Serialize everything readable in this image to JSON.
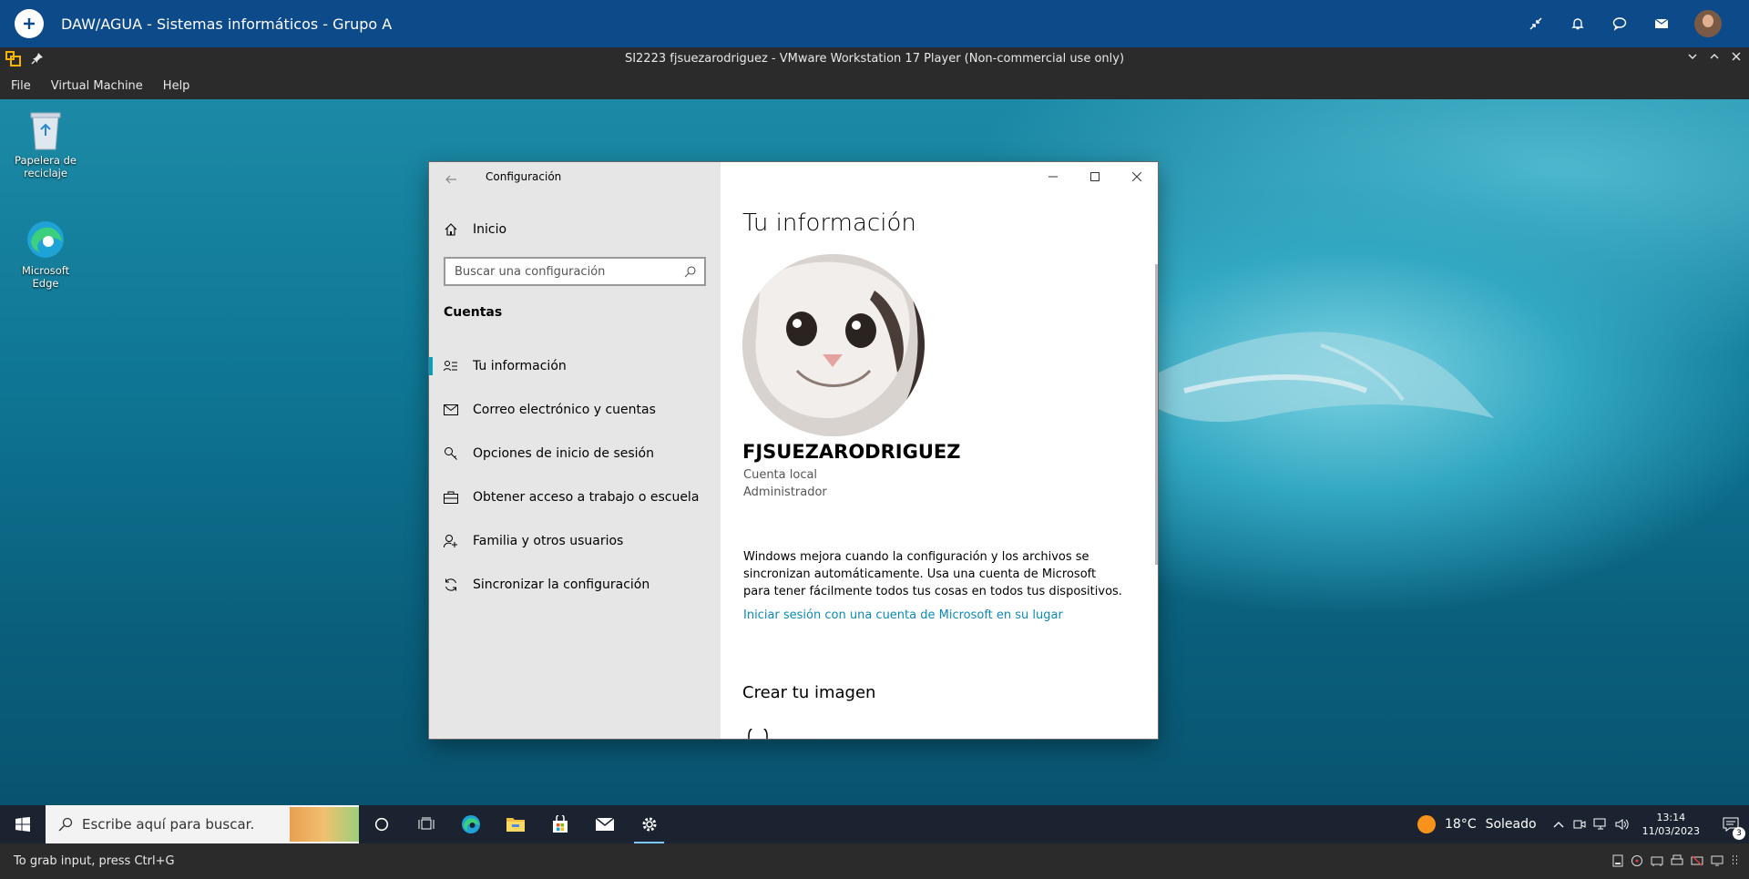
{
  "top_app": {
    "title": "DAW/AGUA - Sistemas informáticos - Grupo A"
  },
  "vmware": {
    "window_title": "SI2223 fjsuezarodriguez - VMware Workstation 17 Player (Non-commercial use only)",
    "menu": [
      "File",
      "Virtual Machine",
      "Help"
    ],
    "status_text": "To grab input, press Ctrl+G"
  },
  "desktop": {
    "icons": [
      {
        "label": "Papelera de reciclaje",
        "icon": "recycle-bin-icon"
      },
      {
        "label": "Microsoft Edge",
        "icon": "edge-icon"
      }
    ]
  },
  "settings": {
    "window_title": "Configuración",
    "home_label": "Inicio",
    "search_placeholder": "Buscar una configuración",
    "section": "Cuentas",
    "nav": [
      {
        "label": "Tu información",
        "icon": "user-info-icon",
        "selected": true
      },
      {
        "label": "Correo electrónico y cuentas",
        "icon": "mail-icon"
      },
      {
        "label": "Opciones de inicio de sesión",
        "icon": "key-icon"
      },
      {
        "label": "Obtener acceso a trabajo o escuela",
        "icon": "briefcase-icon"
      },
      {
        "label": "Familia y otros usuarios",
        "icon": "person-add-icon"
      },
      {
        "label": "Sincronizar la configuración",
        "icon": "sync-icon"
      }
    ],
    "page_title": "Tu información",
    "username": "FJSUEZARODRIGUEZ",
    "account_type": "Cuenta local",
    "role": "Administrador",
    "sync_text": "Windows mejora cuando la configuración y los archivos se sincronizan automáticamente. Usa una cuenta de Microsoft para tener fácilmente todos tus cosas en todos tus dispositivos.",
    "signin_link": "Iniciar sesión con una cuenta de Microsoft en su lugar",
    "create_image_heading": "Crear tu imagen"
  },
  "taskbar": {
    "search_placeholder": "Escribe aquí para buscar.",
    "pinned": [
      "cortana-icon",
      "task-view-icon",
      "edge-icon",
      "file-explorer-icon",
      "store-icon",
      "mail-icon",
      "settings-icon"
    ],
    "weather_temp": "18°C",
    "weather_desc": "Soleado",
    "time": "13:14",
    "date": "11/03/2023",
    "notifications_count": "3"
  },
  "colors": {
    "top_app_bg": "#0d4a8a",
    "accent": "#00a1c1",
    "link": "#0d8ab3"
  }
}
